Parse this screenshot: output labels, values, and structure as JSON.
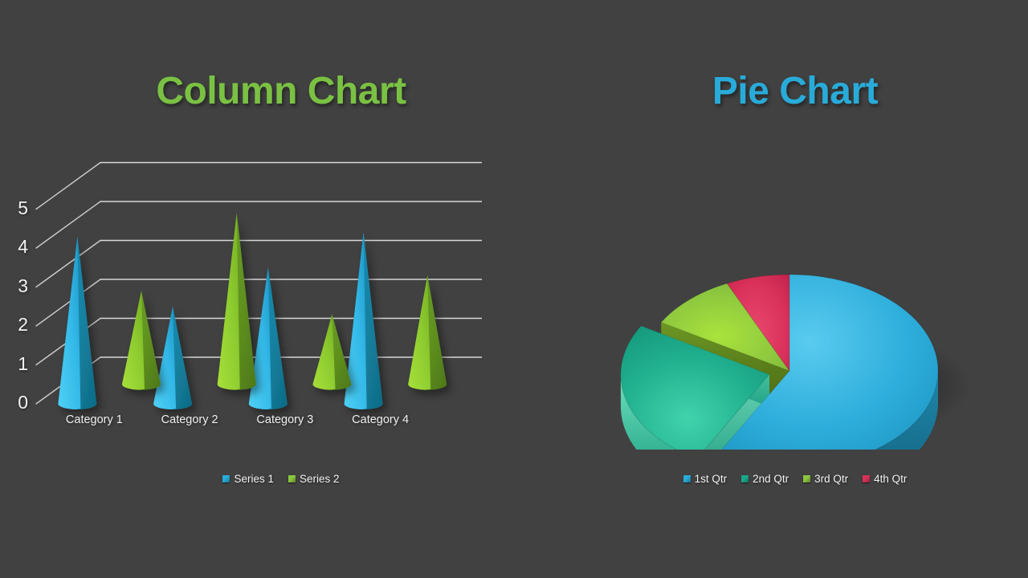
{
  "background_color": "#414141",
  "column_chart": {
    "title": "Column Chart",
    "title_color": "#7AC143",
    "y_axis": {
      "ticks": [
        "0",
        "1",
        "2",
        "3",
        "4",
        "5"
      ]
    },
    "categories": [
      "Category 1",
      "Category 2",
      "Category 3",
      "Category 4"
    ],
    "legend": [
      {
        "label": "Series 1",
        "color": "#29ABD9"
      },
      {
        "label": "Series 2",
        "color": "#8CC63F"
      }
    ]
  },
  "pie_chart": {
    "title": "Pie Chart",
    "title_color": "#29ABD9",
    "legend": [
      {
        "label": "1st Qtr",
        "color": "#29ABD9"
      },
      {
        "label": "2nd Qtr",
        "color": "#1BA98A"
      },
      {
        "label": "3rd Qtr",
        "color": "#8CC63F"
      },
      {
        "label": "4th Qtr",
        "color": "#D9315A"
      }
    ]
  },
  "chart_data": [
    {
      "type": "bar",
      "title": "Column Chart",
      "subtitle": "",
      "style": "3d-cone",
      "xlabel": "",
      "ylabel": "",
      "ylim": [
        0,
        5
      ],
      "yticks": [
        0,
        1,
        2,
        3,
        4,
        5
      ],
      "grid": true,
      "legend_position": "bottom",
      "categories": [
        "Category 1",
        "Category 2",
        "Category 3",
        "Category 4"
      ],
      "series": [
        {
          "name": "Series 1",
          "color": "#29ABD9",
          "values": [
            4.3,
            2.5,
            3.5,
            4.4
          ]
        },
        {
          "name": "Series 2",
          "color": "#8CC63F",
          "values": [
            2.4,
            4.4,
            1.8,
            2.8
          ]
        }
      ]
    },
    {
      "type": "pie",
      "title": "Pie Chart",
      "style": "3d-exploded",
      "legend_position": "bottom",
      "labels": [
        "1st Qtr",
        "2nd Qtr",
        "3rd Qtr",
        "4th Qtr"
      ],
      "values": [
        58.1,
        25.3,
        9.7,
        6.9
      ],
      "colors": [
        "#29ABD9",
        "#1BA98A",
        "#8CC63F",
        "#D9315A"
      ],
      "exploded": [
        false,
        true,
        false,
        false
      ]
    }
  ]
}
